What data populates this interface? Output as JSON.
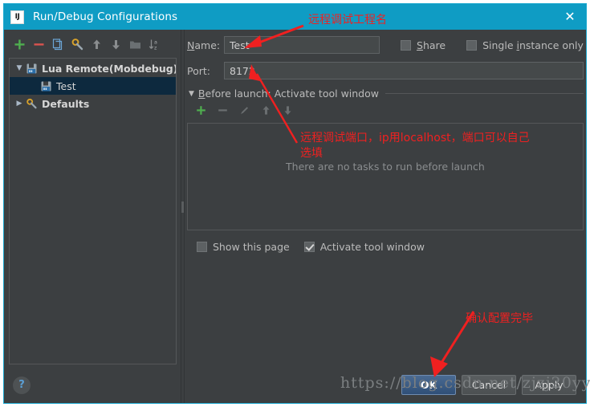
{
  "window": {
    "title": "Run/Debug Configurations",
    "app_icon": "IJ",
    "close_icon": "✕"
  },
  "left_pane": {
    "toolbar": [
      {
        "name": "add-configuration-button",
        "icon": "plus-icon",
        "label": "+"
      },
      {
        "name": "remove-configuration-button",
        "icon": "minus-icon",
        "label": "−"
      },
      {
        "name": "copy-configuration-button",
        "icon": "copy-icon",
        "label": "copy"
      },
      {
        "name": "edit-defaults-button",
        "icon": "wrench-icon",
        "label": "wrench"
      },
      {
        "name": "move-up-button",
        "icon": "arrow-up-icon",
        "label": "↑"
      },
      {
        "name": "move-down-button",
        "icon": "arrow-down-icon",
        "label": "↓"
      },
      {
        "name": "move-into-folder-button",
        "icon": "folder-icon",
        "label": "folder"
      },
      {
        "name": "sort-button",
        "icon": "sort-alpha-icon",
        "label": "sort"
      }
    ],
    "tree": [
      {
        "label": "Lua Remote(Mobdebug)",
        "twisty": "▼",
        "icon": "lua-remote-icon",
        "level": 0,
        "selected": false
      },
      {
        "label": "Test",
        "twisty": "",
        "icon": "lua-remote-icon",
        "level": 1,
        "selected": true
      },
      {
        "label": "Defaults",
        "twisty": "▶",
        "icon": "wrench-icon",
        "level": 0,
        "selected": false
      }
    ],
    "help_button": "?"
  },
  "form": {
    "name_label": "Name:",
    "name_label_mnemonic": "N",
    "name_value": "Test",
    "name_placeholder": "",
    "share_label": "Share",
    "share_label_mnemonic": "S",
    "share_checked": false,
    "single_instance_label": "Single instance only",
    "single_instance_mnemonic": "i",
    "single_instance_checked": false,
    "port_label": "Port:",
    "port_value": "8172",
    "port_placeholder": ""
  },
  "before_launch": {
    "twisty": "▼",
    "title": "Before launch: Activate tool window",
    "title_mnemonic": "B",
    "toolbar": [
      {
        "name": "add-task-button",
        "icon": "plus-icon"
      },
      {
        "name": "remove-task-button",
        "icon": "minus-icon"
      },
      {
        "name": "edit-task-button",
        "icon": "pencil-icon"
      },
      {
        "name": "task-move-up-button",
        "icon": "arrow-up-icon"
      },
      {
        "name": "task-move-down-button",
        "icon": "arrow-down-icon"
      }
    ],
    "empty_message": "There are no tasks to run before launch",
    "show_this_page_label": "Show this page",
    "show_this_page_checked": false,
    "activate_tool_window_label": "Activate tool window",
    "activate_tool_window_checked": true
  },
  "footer": {
    "ok_label": "OK",
    "cancel_label": "Cancel",
    "apply_label": "Apply"
  },
  "watermark": "https://blog.csdn.net/zjzj20yy",
  "annotations": [
    {
      "id": "anno1",
      "text": "远程调试工程名"
    },
    {
      "id": "anno2",
      "text": "远程调试端口，ip用localhost，端口可以自己\n选填"
    },
    {
      "id": "anno3",
      "text": "确认配置完毕"
    }
  ],
  "colors": {
    "titlebar": "#0f9cc4",
    "dialog_bg": "#3c3f41",
    "selection": "#0d293e",
    "annotation_red": "#f02020",
    "accent_green": "#4fae4f"
  }
}
